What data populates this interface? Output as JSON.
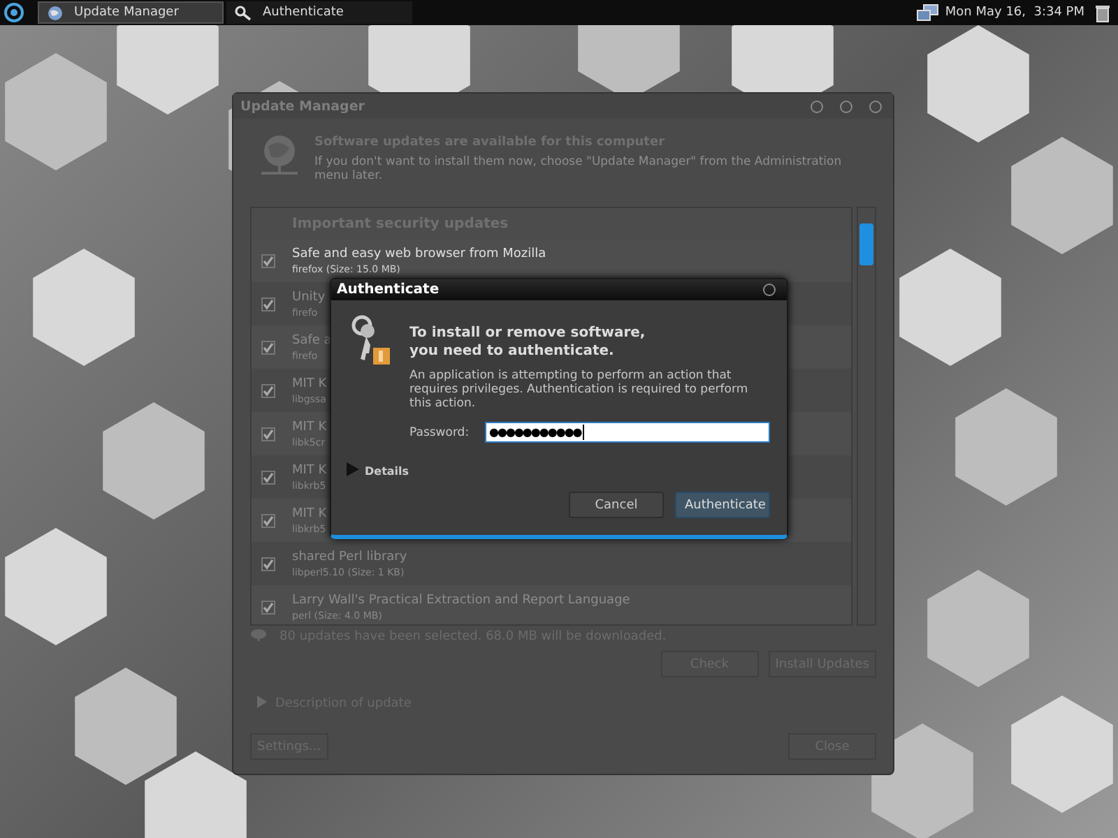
{
  "taskbar": {
    "tasks": [
      {
        "label": "Update Manager",
        "selected": true
      },
      {
        "label": "Authenticate",
        "selected": false
      }
    ],
    "clock": "Mon May 16,  3:34 PM"
  },
  "update_manager": {
    "title": "Update Manager",
    "heading": "Software updates are available for this computer",
    "message": "If you don't want to install them now, choose \"Update Manager\" from the Administration menu later.",
    "group": "Important security updates",
    "updates": [
      {
        "name": "Safe and easy web browser from Mozilla",
        "detail": "firefox (Size: 15.0 MB)",
        "checked": true
      },
      {
        "name": "Unity",
        "detail": "firefo",
        "checked": true
      },
      {
        "name": "Safe a",
        "detail": "firefo",
        "checked": true
      },
      {
        "name": "MIT K",
        "detail": "libgssa",
        "checked": true
      },
      {
        "name": "MIT K",
        "detail": "libk5cr",
        "checked": true
      },
      {
        "name": "MIT K",
        "detail": "libkrb5",
        "checked": true
      },
      {
        "name": "MIT K",
        "detail": "libkrb5",
        "checked": true
      },
      {
        "name": "shared Perl library",
        "detail": "libperl5.10 (Size: 1 KB)",
        "checked": true
      },
      {
        "name": "Larry Wall's Practical Extraction and Report Language",
        "detail": "perl (Size: 4.0 MB)",
        "checked": true
      }
    ],
    "status": "80 updates have been selected. 68.0 MB will be downloaded.",
    "check_button": "Check",
    "install_button": "Install Updates",
    "description": "Description of update",
    "settings_button": "Settings...",
    "close_button": "Close"
  },
  "auth_dialog": {
    "title": "Authenticate",
    "heading": "To install or remove software,\nyou need to authenticate.",
    "message": "An application is attempting to perform an action that requires privileges. Authentication is required to perform this action.",
    "password_label": "Password:",
    "password_value": "●●●●●●●●●●●",
    "details": "Details",
    "cancel_button": "Cancel",
    "ok_button": "Authenticate"
  }
}
